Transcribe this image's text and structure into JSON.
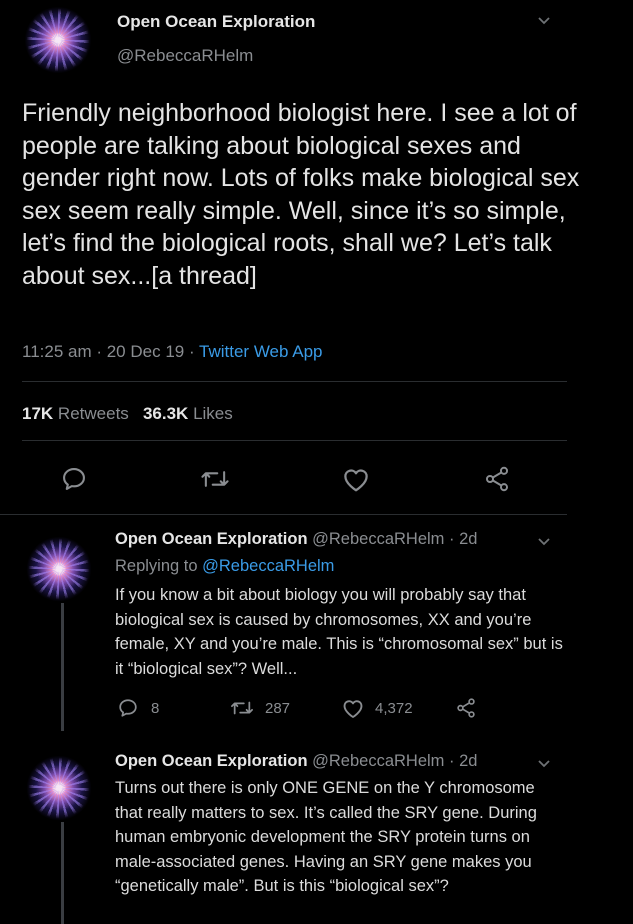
{
  "main_tweet": {
    "display_name": "Open Ocean Exploration",
    "handle": "@RebeccaRHelm",
    "text": "Friendly neighborhood biologist here. I see a lot of people are talking about biological sexes and gender right now. Lots of folks make biological sex sex seem really simple. Well, since it’s so simple, let’s find the biological roots, shall we?  Let’s talk about sex...[a thread]",
    "time": "11:25 am · 20 Dec 19 · ",
    "app": "Twitter Web App",
    "retweets_count": "17K",
    "retweets_label": "Retweets",
    "likes_count": "36.3K",
    "likes_label": "Likes"
  },
  "replies": [
    {
      "display_name": "Open Ocean Exploration",
      "handle_time": "@RebeccaRHelm · 2d",
      "replying_prefix": "Replying to ",
      "replying_to": "@RebeccaRHelm",
      "text": "If you know a bit about biology you will probably say that biological sex is caused by chromosomes, XX and you’re female, XY and you’re male. This is “chromosomal sex” but is it “biological sex”? Well...",
      "reply_count": "8",
      "retweet_count": "287",
      "like_count": "4,372"
    },
    {
      "display_name": "Open Ocean Exploration",
      "handle_time": "@RebeccaRHelm · 2d",
      "text": "Turns out there is only ONE GENE on the Y chromosome that really matters to sex. It’s called the SRY gene. During human embryonic development the SRY protein turns on male-associated genes. Having an SRY gene makes you “genetically male”. But is this “biological sex”?"
    }
  ],
  "icons": {
    "reply": "reply-icon",
    "retweet": "retweet-icon",
    "like": "heart-icon",
    "share": "share-icon",
    "more": "chevron-down-icon"
  },
  "colors": {
    "background": "#000000",
    "link": "#3a9be6",
    "secondary_text": "#8a8d91"
  }
}
